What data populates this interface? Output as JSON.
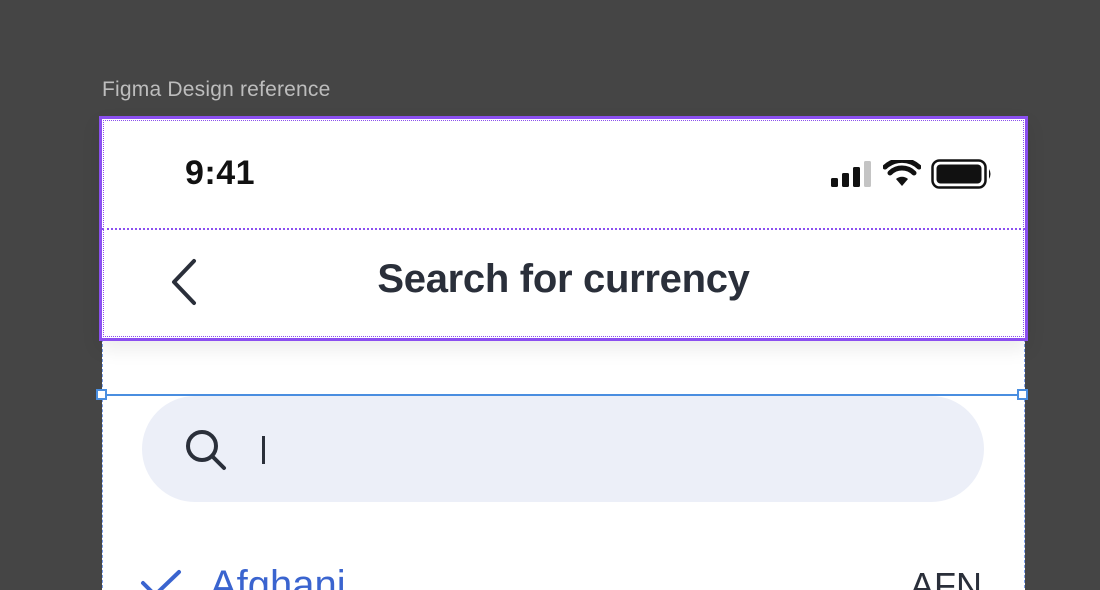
{
  "caption": "Figma Design reference",
  "status_bar": {
    "time": "9:41",
    "icons": [
      "cellular-signal-icon",
      "wifi-icon",
      "battery-icon"
    ]
  },
  "nav": {
    "back_icon": "chevron-left-icon",
    "title": "Search for currency"
  },
  "search": {
    "icon": "search-icon",
    "value": ""
  },
  "currency_list": [
    {
      "name": "Afghani",
      "code": "AFN",
      "selected": true
    }
  ],
  "colors": {
    "canvas": "#454545",
    "header_selection": "#8b4ff0",
    "search_selection": "#4a8ee0",
    "search_background": "#eceff8",
    "selected_currency": "#3a64cf",
    "title_text": "#2a2f3a"
  }
}
